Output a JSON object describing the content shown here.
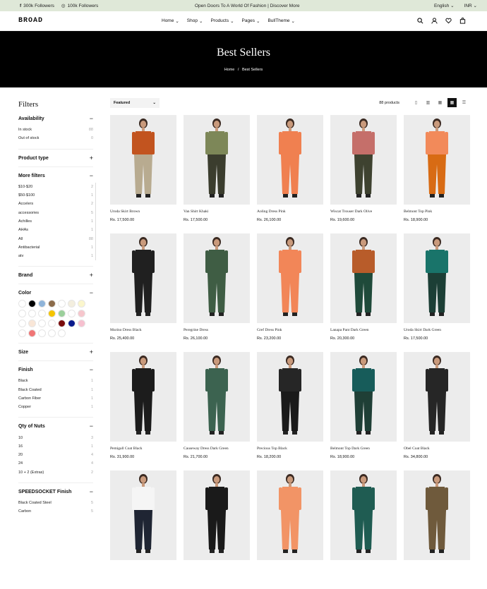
{
  "topbar": {
    "followers_fb": "300k Followers",
    "followers_ig": "100k Followers",
    "announcement": "Open Doors To A World Of Fashion | Discover More",
    "language": "English",
    "currency": "INR"
  },
  "nav": {
    "logo": "BROAD",
    "menu": [
      "Home",
      "Shop",
      "Products",
      "Pages",
      "BullTheme"
    ]
  },
  "hero": {
    "title": "Best Sellers",
    "home": "Home",
    "sep": "/",
    "current": "Best Sellers"
  },
  "filters": {
    "title": "Filters",
    "availability": {
      "title": "Availability",
      "items": [
        {
          "label": "In stock",
          "count": "88"
        },
        {
          "label": "Out of stock",
          "count": "0"
        }
      ]
    },
    "product_type": {
      "title": "Product type"
    },
    "more": {
      "title": "More filters",
      "items": [
        {
          "label": "$10-$20",
          "count": "2"
        },
        {
          "label": "$50-$100",
          "count": "1"
        },
        {
          "label": "Accelers",
          "count": "2"
        },
        {
          "label": "accessories",
          "count": "5"
        },
        {
          "label": "Achilles",
          "count": "1"
        },
        {
          "label": "AHAs",
          "count": "1"
        },
        {
          "label": "All",
          "count": "88"
        },
        {
          "label": "Antibacterial",
          "count": "1"
        },
        {
          "label": "atv",
          "count": "1"
        }
      ]
    },
    "brand": {
      "title": "Brand"
    },
    "color": {
      "title": "Color",
      "swatches": [
        "#ffffff",
        "#000000",
        "#8fb4d9",
        "#8b6b4a",
        "#ffffff",
        "#f3eede",
        "#fbf6cc",
        "#ffffff",
        "#ffffff",
        "#ffffff",
        "#f5c400",
        "#9bcf9b",
        "#ffffff",
        "#f6c6cc",
        "#ffffff",
        "#f9e6d7",
        "#ffffff",
        "#ffffff",
        "#7a0c0c",
        "#0a1a8c",
        "#f6c0cf",
        "#ffffff",
        "#f07575",
        "#ffffff",
        "#ffffff",
        "#ffffff"
      ]
    },
    "size": {
      "title": "Size"
    },
    "finish": {
      "title": "Finish",
      "items": [
        {
          "label": "Black",
          "count": "1"
        },
        {
          "label": "Black Coated",
          "count": "1"
        },
        {
          "label": "Carbon Fiber",
          "count": "1"
        },
        {
          "label": "Copper",
          "count": "1"
        }
      ]
    },
    "nuts": {
      "title": "Qty of Nuts",
      "items": [
        {
          "label": "10",
          "count": "3"
        },
        {
          "label": "16",
          "count": "1"
        },
        {
          "label": "20",
          "count": "4"
        },
        {
          "label": "24",
          "count": "4"
        },
        {
          "label": "10 + 2 (Extras)",
          "count": "2"
        }
      ]
    },
    "speed": {
      "title": "SPEEDSOCKET Finish",
      "items": [
        {
          "label": "Black Coated Steel",
          "count": "5"
        },
        {
          "label": "Carbon",
          "count": "5"
        }
      ]
    }
  },
  "toolbar": {
    "sort": "Featured",
    "count": "88 products"
  },
  "products": [
    {
      "name": "Uroda Skirt Brown",
      "price": "Rs. 17,500.00",
      "top": "#c2541f",
      "bottom": "#b8ab90",
      "bg": "#ececec"
    },
    {
      "name": "Van Shirt Khaki",
      "price": "Rs. 17,500.00",
      "top": "#7d8758",
      "bottom": "#3b3d2e",
      "bg": "#ececec"
    },
    {
      "name": "Aoling Dress Pink",
      "price": "Rs. 26,100.00",
      "top": "#f08050",
      "bottom": "#f08050",
      "bg": "#ececec"
    },
    {
      "name": "Wiscat Trouser Dark Olive",
      "price": "Rs. 19,600.00",
      "top": "#c56f6a",
      "bottom": "#3e4230",
      "bg": "#ececec"
    },
    {
      "name": "Belmont Top Pink",
      "price": "Rs. 18,900.00",
      "top": "#f28a5a",
      "bottom": "#d86b14",
      "bg": "#ececec"
    },
    {
      "name": "Murino Dress Black",
      "price": "Rs. 25,400.00",
      "top": "#202020",
      "bottom": "#202020",
      "bg": "#ececec"
    },
    {
      "name": "Peregrine Dress",
      "price": "Rs. 26,100.00",
      "top": "#3f5d44",
      "bottom": "#3f5d44",
      "bg": "#ececec"
    },
    {
      "name": "Gref Dress Pink",
      "price": "Rs. 23,200.00",
      "top": "#f28658",
      "bottom": "#f28658",
      "bg": "#ececec"
    },
    {
      "name": "Lanapa Pant Dark Green",
      "price": "Rs. 20,300.00",
      "top": "#b85c2a",
      "bottom": "#1f4a3a",
      "bg": "#ececec"
    },
    {
      "name": "Uroda Skirt Dark Green",
      "price": "Rs. 17,500.00",
      "top": "#19746a",
      "bottom": "#1c3f36",
      "bg": "#ececec"
    },
    {
      "name": "Pemigall Coat Black",
      "price": "Rs. 31,900.00",
      "top": "#1c1c1c",
      "bottom": "#1c1c1c",
      "bg": "#ececec"
    },
    {
      "name": "Causeway Dress Dark Green",
      "price": "Rs. 21,700.00",
      "top": "#3c6350",
      "bottom": "#3c6350",
      "bg": "#ececec"
    },
    {
      "name": "Precious Top Black",
      "price": "Rs. 18,200.00",
      "top": "#262626",
      "bottom": "#1a1a1a",
      "bg": "#ececec"
    },
    {
      "name": "Belmont Top Dark Green",
      "price": "Rs. 18,900.00",
      "top": "#175c5a",
      "bottom": "#1f3f36",
      "bg": "#ececec"
    },
    {
      "name": "Obel Coat Black",
      "price": "Rs. 34,800.00",
      "top": "#262626",
      "bottom": "#262626",
      "bg": "#ececec"
    },
    {
      "name": "",
      "price": "",
      "top": "#f5f5f5",
      "bottom": "#1f2533",
      "bg": "#ececec"
    },
    {
      "name": "",
      "price": "",
      "top": "#1a1a1a",
      "bottom": "#1a1a1a",
      "bg": "#ececec"
    },
    {
      "name": "",
      "price": "",
      "top": "#f29466",
      "bottom": "#f29466",
      "bg": "#ececec"
    },
    {
      "name": "",
      "price": "",
      "top": "#1f5c52",
      "bottom": "#1f5c52",
      "bg": "#ececec"
    },
    {
      "name": "",
      "price": "",
      "top": "#6f5a3c",
      "bottom": "#6f5a3c",
      "bg": "#ececec"
    }
  ]
}
